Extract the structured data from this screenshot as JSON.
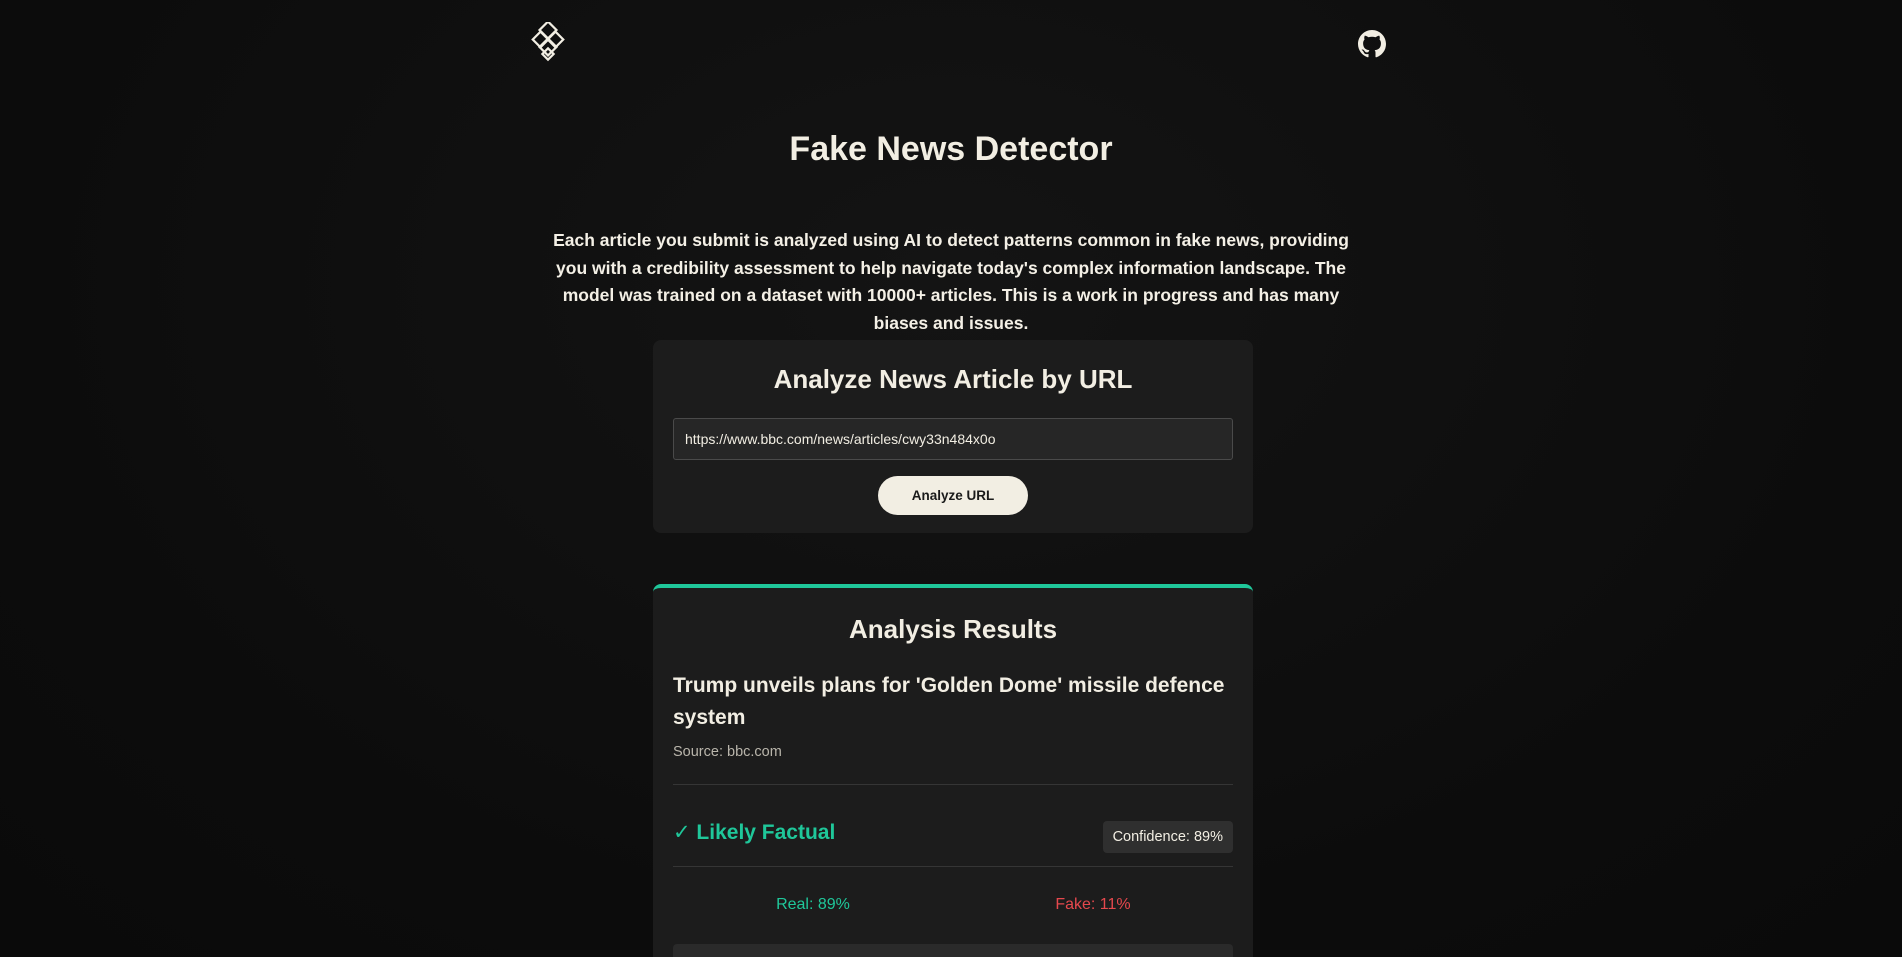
{
  "header": {
    "logo_icon": "knot-logo-icon",
    "github_icon": "github-icon"
  },
  "main": {
    "title": "Fake News Detector",
    "description": "Each article you submit is analyzed using AI to detect patterns common in fake news, providing you with a credibility assessment to help navigate today's complex information landscape. The model was trained on a dataset with 10000+ articles. This is a work in progress and has many biases and issues."
  },
  "url_form": {
    "heading": "Analyze News Article by URL",
    "url_value": "https://www.bbc.com/news/articles/cwy33n484x0o",
    "button_label": "Analyze URL"
  },
  "results": {
    "heading": "Analysis Results",
    "article_title": "Trump unveils plans for 'Golden Dome' missile defence system",
    "source": "Source: bbc.com",
    "verdict": "✓ Likely Factual",
    "confidence": "Confidence: 89%",
    "real": "Real: 89%",
    "fake": "Fake: 11%"
  },
  "colors": {
    "background": "#0f0f0f",
    "card": "#1c1c1c",
    "accent_real": "#1fc79a",
    "accent_fake": "#e5484d",
    "button_bg": "#f2eee3"
  }
}
